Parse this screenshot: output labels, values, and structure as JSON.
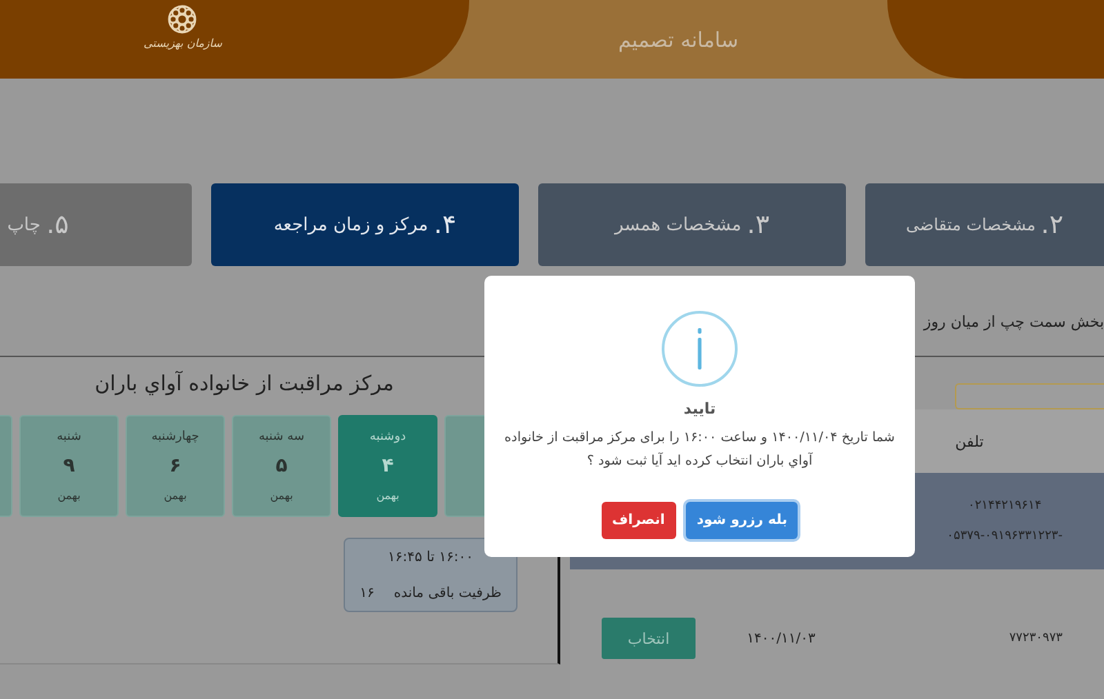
{
  "header": {
    "title": "سامانه تصمیم",
    "logo_caption": "سازمان بهزیستی"
  },
  "steps": [
    {
      "number": "۲.",
      "label": "مشخصات متقاضی",
      "selected": false,
      "completed": true
    },
    {
      "number": "۳.",
      "label": "مشخصات همسر",
      "selected": false,
      "completed": true
    },
    {
      "number": "۴.",
      "label": "مرکز و زمان مراجعه",
      "selected": true,
      "completed": false
    },
    {
      "number": "۵.",
      "label": "چاپ",
      "selected": false,
      "completed": false
    }
  ],
  "instruction": "بخش سمت چپ از میان روز",
  "center": {
    "title": "مرکز مراقبت از خانواده آواي باران",
    "days": [
      {
        "selected": false
      },
      {
        "day": "دوشنبه",
        "number": "۴",
        "month": "بهمن",
        "selected": true
      },
      {
        "day": "سه شنبه",
        "number": "۵",
        "month": "بهمن",
        "selected": false
      },
      {
        "day": "چهارشنبه",
        "number": "۶",
        "month": "بهمن",
        "selected": false
      },
      {
        "day": "شنبه",
        "number": "۹",
        "month": "بهمن",
        "selected": false
      },
      {
        "selected": false
      }
    ],
    "slots": [
      {
        "time": "۱۶:۰۰ تا ۱۶:۴۵",
        "capacity_label": "ظرفیت باقی مانده",
        "capacity": "۱۶"
      }
    ]
  },
  "table": {
    "columns": [
      "تلفن"
    ],
    "rows": [
      {
        "phone_lines": [
          "۰۲۱۴۴۲۱۹۶۱۴",
          "۰۵۳۷۹-۰۹۱۹۶۳۳۱۲۲۳-"
        ],
        "selected": true
      },
      {
        "action": "انتخاب",
        "date": "۱۴۰۰/۱۱/۰۳",
        "phone_lines": [
          "۷۷۲۳۰۹۷۳"
        ],
        "selected": false
      }
    ]
  },
  "dialog": {
    "title": "تایید",
    "message": "شما تاریخ ۱۴۰۰/۱۱/۰۴ و ساعت ۱۶:۰۰ را برای مرکز مراقبت از خانواده آواي باران انتخاب کرده اید آیا ثبت شود ؟",
    "buttons": [
      {
        "label": "بله رزرو شود",
        "kind": "confirm"
      },
      {
        "label": "انصراف",
        "kind": "cancel"
      }
    ]
  }
}
